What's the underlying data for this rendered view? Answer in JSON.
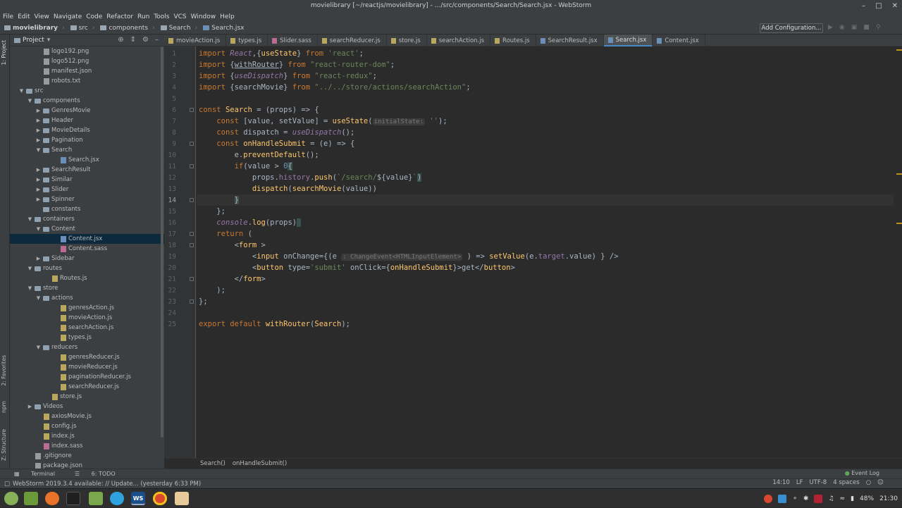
{
  "window": {
    "title": "movielibrary [~/reactjs/movielibrary] - .../src/components/Search/Search.jsx - WebStorm"
  },
  "menu": [
    "File",
    "Edit",
    "View",
    "Navigate",
    "Code",
    "Refactor",
    "Run",
    "Tools",
    "VCS",
    "Window",
    "Help"
  ],
  "breadcrumbs": [
    "movielibrary",
    "src",
    "components",
    "Search",
    "Search.jsx"
  ],
  "toolbar": {
    "add_config": "Add Configuration..."
  },
  "left_tools": {
    "project": "1: Project",
    "favorites": "2: Favorites",
    "npm": "npm",
    "structure": "Z: Structure"
  },
  "project_panel": {
    "title": "Project"
  },
  "tree": [
    {
      "label": "logo192.png",
      "depth": 3,
      "type": "gen",
      "exp": ""
    },
    {
      "label": "logo512.png",
      "depth": 3,
      "type": "gen",
      "exp": ""
    },
    {
      "label": "manifest.json",
      "depth": 3,
      "type": "gen",
      "exp": ""
    },
    {
      "label": "robots.txt",
      "depth": 3,
      "type": "gen",
      "exp": ""
    },
    {
      "label": "src",
      "depth": 1,
      "type": "folder",
      "exp": "open"
    },
    {
      "label": "components",
      "depth": 2,
      "type": "folder",
      "exp": "open"
    },
    {
      "label": "GenresMovie",
      "depth": 3,
      "type": "folder",
      "exp": "closed"
    },
    {
      "label": "Header",
      "depth": 3,
      "type": "folder",
      "exp": "closed"
    },
    {
      "label": "MovieDetails",
      "depth": 3,
      "type": "folder",
      "exp": "closed"
    },
    {
      "label": "Pagination",
      "depth": 3,
      "type": "folder",
      "exp": "closed"
    },
    {
      "label": "Search",
      "depth": 3,
      "type": "folder",
      "exp": "open"
    },
    {
      "label": "Search.jsx",
      "depth": 5,
      "type": "jsx",
      "exp": ""
    },
    {
      "label": "SearchResult",
      "depth": 3,
      "type": "folder",
      "exp": "closed"
    },
    {
      "label": "Similar",
      "depth": 3,
      "type": "folder",
      "exp": "closed"
    },
    {
      "label": "Slider",
      "depth": 3,
      "type": "folder",
      "exp": "closed"
    },
    {
      "label": "Spinner",
      "depth": 3,
      "type": "folder",
      "exp": "closed"
    },
    {
      "label": "constants",
      "depth": 3,
      "type": "folder",
      "exp": ""
    },
    {
      "label": "containers",
      "depth": 2,
      "type": "folder",
      "exp": "open"
    },
    {
      "label": "Content",
      "depth": 3,
      "type": "folder",
      "exp": "open"
    },
    {
      "label": "Content.jsx",
      "depth": 5,
      "type": "jsx",
      "exp": "",
      "selected": true
    },
    {
      "label": "Content.sass",
      "depth": 5,
      "type": "sass",
      "exp": ""
    },
    {
      "label": "Sidebar",
      "depth": 3,
      "type": "folder",
      "exp": "closed"
    },
    {
      "label": "routes",
      "depth": 2,
      "type": "folder",
      "exp": "open"
    },
    {
      "label": "Routes.js",
      "depth": 4,
      "type": "js",
      "exp": ""
    },
    {
      "label": "store",
      "depth": 2,
      "type": "folder",
      "exp": "open"
    },
    {
      "label": "actions",
      "depth": 3,
      "type": "folder",
      "exp": "open"
    },
    {
      "label": "genresAction.js",
      "depth": 5,
      "type": "js",
      "exp": ""
    },
    {
      "label": "movieAction.js",
      "depth": 5,
      "type": "js",
      "exp": ""
    },
    {
      "label": "searchAction.js",
      "depth": 5,
      "type": "js",
      "exp": ""
    },
    {
      "label": "types.js",
      "depth": 5,
      "type": "js",
      "exp": ""
    },
    {
      "label": "reducers",
      "depth": 3,
      "type": "folder",
      "exp": "open"
    },
    {
      "label": "genresReducer.js",
      "depth": 5,
      "type": "js",
      "exp": ""
    },
    {
      "label": "movieReducer.js",
      "depth": 5,
      "type": "js",
      "exp": ""
    },
    {
      "label": "paginationReducer.js",
      "depth": 5,
      "type": "js",
      "exp": ""
    },
    {
      "label": "searchReducer.js",
      "depth": 5,
      "type": "js",
      "exp": ""
    },
    {
      "label": "store.js",
      "depth": 4,
      "type": "js",
      "exp": ""
    },
    {
      "label": "Videos",
      "depth": 2,
      "type": "folder",
      "exp": "closed"
    },
    {
      "label": "axiosMovie.js",
      "depth": 3,
      "type": "js",
      "exp": ""
    },
    {
      "label": "config.js",
      "depth": 3,
      "type": "js",
      "exp": ""
    },
    {
      "label": "index.js",
      "depth": 3,
      "type": "js",
      "exp": ""
    },
    {
      "label": "index.sass",
      "depth": 3,
      "type": "sass",
      "exp": ""
    },
    {
      "label": ".gitignore",
      "depth": 2,
      "type": "gen",
      "exp": ""
    },
    {
      "label": "package.json",
      "depth": 2,
      "type": "gen",
      "exp": ""
    }
  ],
  "tabs": [
    {
      "label": "movieAction.js",
      "type": "js"
    },
    {
      "label": "types.js",
      "type": "js"
    },
    {
      "label": "Slider.sass",
      "type": "sass"
    },
    {
      "label": "searchReducer.js",
      "type": "js"
    },
    {
      "label": "store.js",
      "type": "js"
    },
    {
      "label": "searchAction.js",
      "type": "js"
    },
    {
      "label": "Routes.js",
      "type": "js"
    },
    {
      "label": "SearchResult.jsx",
      "type": "jsx"
    },
    {
      "label": "Search.jsx",
      "type": "jsx",
      "active": true
    },
    {
      "label": "Content.jsx",
      "type": "jsx"
    }
  ],
  "current_line": 14,
  "code": [
    [
      [
        "k",
        "import "
      ],
      [
        "pk",
        "React"
      ],
      [
        "",
        ","
      ],
      [
        "",
        "{"
      ],
      [
        "f",
        "useState"
      ],
      [
        "",
        "} "
      ],
      [
        "k",
        "from "
      ],
      [
        "s",
        "'react'"
      ],
      [
        "",
        ";"
      ]
    ],
    [
      [
        "k",
        "import "
      ],
      [
        "",
        "{"
      ],
      [
        "u",
        "withRouter"
      ],
      [
        "",
        "} "
      ],
      [
        "k",
        "from "
      ],
      [
        "s",
        "\"react-router-dom\""
      ],
      [
        "",
        ";"
      ]
    ],
    [
      [
        "k",
        "import "
      ],
      [
        "",
        "{"
      ],
      [
        "pk",
        "useDispatch"
      ],
      [
        "",
        "} "
      ],
      [
        "k",
        "from "
      ],
      [
        "s",
        "\"react-redux\""
      ],
      [
        "",
        ";"
      ]
    ],
    [
      [
        "k",
        "import "
      ],
      [
        "",
        "{searchMovie} "
      ],
      [
        "k",
        "from "
      ],
      [
        "s",
        "\"../../store/actions/searchAction\""
      ],
      [
        "",
        ";"
      ]
    ],
    [],
    [
      [
        "k",
        "const "
      ],
      [
        "f",
        "Search"
      ],
      [
        "",
        " = (props) => {"
      ]
    ],
    [
      [
        "",
        "    "
      ],
      [
        "k",
        "const "
      ],
      [
        "",
        "[value, setValue] = "
      ],
      [
        "f",
        "useState"
      ],
      [
        "",
        "("
      ],
      [
        "hint",
        "initialState:"
      ],
      [
        "s",
        " ''"
      ],
      [
        "",
        ");"
      ]
    ],
    [
      [
        "",
        "    "
      ],
      [
        "k",
        "const "
      ],
      [
        "",
        "dispatch = "
      ],
      [
        "pk",
        "useDispatch"
      ],
      [
        "",
        "();"
      ]
    ],
    [
      [
        "",
        "    "
      ],
      [
        "k",
        "const "
      ],
      [
        "f",
        "onHandleSubmit"
      ],
      [
        "",
        " = (e) => {"
      ]
    ],
    [
      [
        "",
        "        e."
      ],
      [
        "f",
        "preventDefault"
      ],
      [
        "",
        "();"
      ]
    ],
    [
      [
        "",
        "        "
      ],
      [
        "k",
        "if"
      ],
      [
        "",
        "(value > "
      ],
      [
        "n",
        "0"
      ],
      [
        ") "
      ],
      [
        "hl",
        "{"
      ]
    ],
    [
      [
        "",
        "            props."
      ],
      [
        "p",
        "history"
      ],
      [
        "",
        "."
      ],
      [
        "f",
        "push"
      ],
      [
        "",
        "("
      ],
      [
        "s",
        "`/search/"
      ],
      [
        "",
        "${value}"
      ],
      [
        "s",
        "`"
      ],
      [
        "hl",
        ")"
      ]
    ],
    [
      [
        "",
        "            "
      ],
      [
        "f",
        "dispatch"
      ],
      [
        "",
        "("
      ],
      [
        "f",
        "searchMovie"
      ],
      [
        "",
        "(value))"
      ]
    ],
    [
      [
        "",
        "        "
      ],
      [
        "hl",
        "}"
      ]
    ],
    [
      [
        "",
        "    };"
      ]
    ],
    [
      [
        "",
        "    "
      ],
      [
        "pk",
        "console"
      ],
      [
        "",
        "."
      ],
      [
        "f",
        "log"
      ],
      [
        "",
        "(props)"
      ],
      [
        "hl",
        " "
      ]
    ],
    [
      [
        "",
        "    "
      ],
      [
        "k",
        "return "
      ],
      [
        "",
        "("
      ]
    ],
    [
      [
        "",
        "        <"
      ],
      [
        "f",
        "form"
      ],
      [
        "",
        " >"
      ]
    ],
    [
      [
        "",
        "            <"
      ],
      [
        "f",
        "input "
      ],
      [
        "",
        "onChange={(e "
      ],
      [
        "hint",
        ": ChangeEvent<HTMLInputElement>"
      ],
      [
        "",
        " ) => "
      ],
      [
        "f",
        "setValue"
      ],
      [
        "",
        "(e."
      ],
      [
        "p",
        "target"
      ],
      [
        "",
        ".value) } />"
      ]
    ],
    [
      [
        "",
        "            <"
      ],
      [
        "f",
        "button "
      ],
      [
        "",
        "type="
      ],
      [
        "s",
        "'submit'"
      ],
      [
        "",
        " onClick={"
      ],
      [
        "f",
        "onHandleSubmit"
      ],
      [
        "",
        "}>get</"
      ],
      [
        "f",
        "button"
      ],
      [
        "",
        ">"
      ]
    ],
    [
      [
        "",
        "        </"
      ],
      [
        "f",
        "form"
      ],
      [
        "",
        ">"
      ]
    ],
    [
      [
        "",
        "    );"
      ]
    ],
    [
      [
        "",
        "};"
      ]
    ],
    [],
    [
      [
        "k",
        "export default "
      ],
      [
        "f",
        "withRouter"
      ],
      [
        "",
        "("
      ],
      [
        "f",
        "Search"
      ],
      [
        "",
        ");"
      ]
    ]
  ],
  "editor_breadcrumb": [
    "Search()",
    "onHandleSubmit()"
  ],
  "bottom_tools": {
    "terminal": "Terminal",
    "todo": "6: TODO",
    "event_log": "Event Log"
  },
  "status": {
    "message": "WebStorm 2019.3.4 available: // Update... (yesterday 6:33 PM)",
    "position": "14:10",
    "line_sep": "LF",
    "encoding": "UTF-8",
    "indent": "4 spaces"
  },
  "tray": {
    "battery": "48%",
    "clock": "21:30",
    "ws_label": "WS"
  }
}
